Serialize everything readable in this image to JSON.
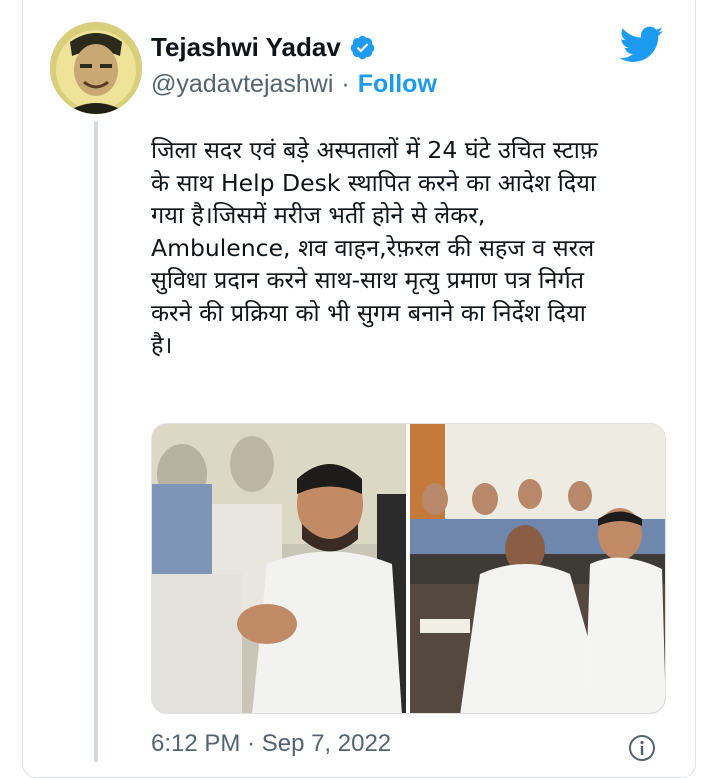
{
  "author": {
    "name": "Tejashwi Yadav",
    "handle": "@yadavtejashwi",
    "separator": "·",
    "follow_label": "Follow"
  },
  "tweet": {
    "text": "जिला सदर एवं बड़े अस्पतालों में 24 घंटे उचित स्टाफ़\nके साथ Help Desk स्थापित करने का आदेश दिया\nगया है।जिसमें मरीज भर्ती होने से लेकर,\nAmbulence, शव वाहन,रेफ़रल की सहज व सरल\nसुविधा प्रदान करने साथ-साथ मृत्यु प्रमाण पत्र निर्गत\nकरने की प्रक्रिया को भी सुगम बनाने का निर्देश दिया\nहै।",
    "timestamp": "6:12 PM · Sep 7, 2022"
  },
  "icons": {
    "verified": "verified-badge-icon",
    "brand": "twitter-bird-icon",
    "info": "info-icon"
  },
  "colors": {
    "accent": "#1d9bf0",
    "text": "#0f1419",
    "secondary": "#536471",
    "border": "#cfd9de"
  }
}
